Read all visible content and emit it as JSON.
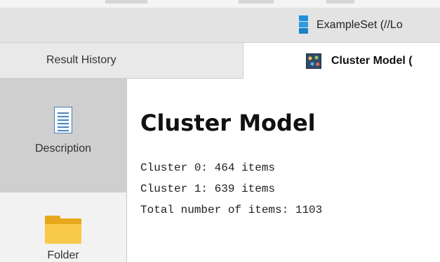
{
  "tabs_top": {
    "example_tab_label": "ExampleSet (//Lo"
  },
  "tabs_second": {
    "history_label": "Result History",
    "cluster_label": "Cluster Model ("
  },
  "sidebar": {
    "items": [
      {
        "label": "Description",
        "icon": "document-icon",
        "selected": true
      },
      {
        "label": "Folder",
        "icon": "folder-icon",
        "selected": false
      }
    ]
  },
  "content": {
    "title": "Cluster Model",
    "lines": [
      "Cluster 0: 464 items",
      "Cluster 1: 639 items",
      "Total number of items: 1103"
    ]
  }
}
